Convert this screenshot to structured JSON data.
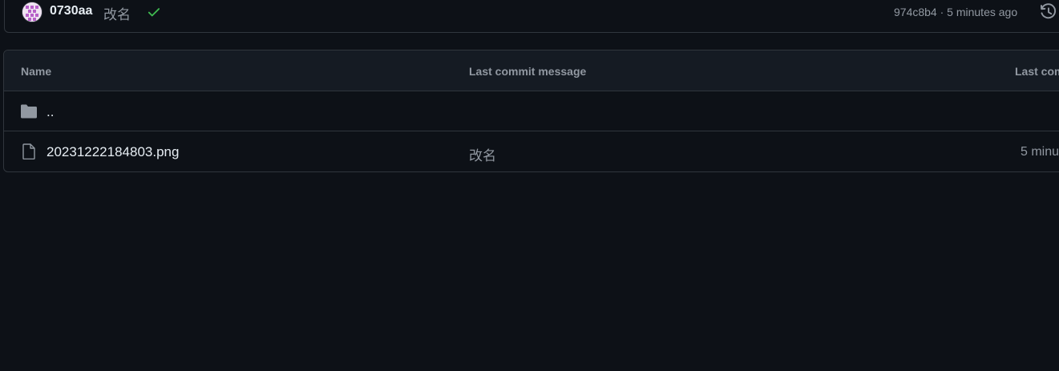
{
  "latest_commit": {
    "author": "0730aa",
    "message": "改名",
    "status_icon": "check-icon",
    "status_color": "#3fb950",
    "meta": "974c8b4 · 5 minutes ago",
    "history_icon": "history-icon"
  },
  "table": {
    "headers": {
      "name": "Name",
      "message": "Last commit message",
      "date": "Last com"
    },
    "parent": {
      "icon": "folder-icon",
      "label": ".."
    },
    "rows": [
      {
        "icon": "file-icon",
        "name": "20231222184803.png",
        "message": "改名",
        "date": "5 minu"
      }
    ]
  },
  "colors": {
    "background": "#0d1117",
    "header_bg": "#151b23",
    "border": "#30363d",
    "muted_text": "#9198a1",
    "primary_text": "#e6edf3"
  }
}
